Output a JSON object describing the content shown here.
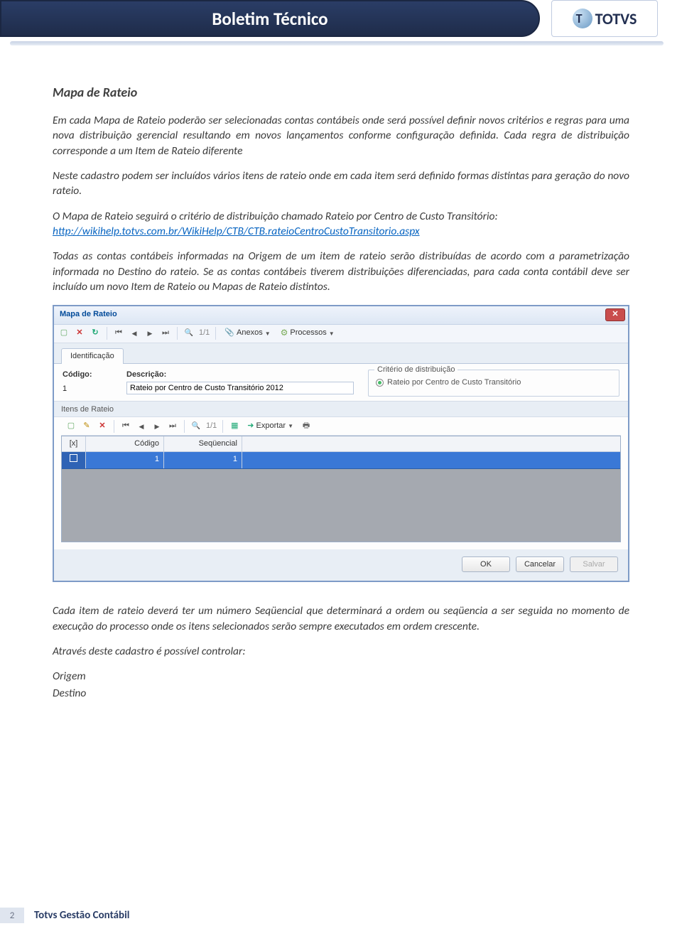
{
  "header": {
    "ribbon_title": "Boletim Técnico",
    "logo_text": "TOTVS"
  },
  "content": {
    "section_title": "Mapa de Rateio",
    "para1": "Em cada Mapa de Rateio poderão ser selecionadas contas contábeis onde será possível definir novos critérios e regras para uma nova distribuição gerencial resultando em novos lançamentos conforme configuração definida. Cada regra de distribuição corresponde a um Item de Rateio diferente",
    "para2": "Neste cadastro podem ser incluídos vários itens de rateio onde em cada item será definido formas distintas para geração do novo rateio.",
    "para3_pre": "O Mapa de Rateio seguirá o critério de distribuição chamado Rateio por Centro de Custo Transitório:",
    "para3_link": "http://wikihelp.totvs.com.br/WikiHelp/CTB/CTB.rateioCentroCustoTransitorio.aspx",
    "para4": "Todas as contas contábeis informadas na Origem de um item de rateio serão distribuídas de acordo com a parametrização informada no Destino do rateio. Se as contas contábeis tiverem distribuições diferenciadas, para cada conta contábil deve ser incluído um novo Item de Rateio ou Mapas de Rateio distintos.",
    "para5": "Cada item de rateio deverá ter um número Seqüencial que determinará a ordem ou seqüencia a ser seguida no momento de execução do processo onde os itens selecionados serão sempre executados em ordem crescente.",
    "para6": "Através deste cadastro é possível controlar:",
    "list": [
      "Origem",
      "Destino"
    ]
  },
  "window": {
    "title": "Mapa de Rateio",
    "toolbar1": {
      "page": "1/1",
      "attach": "Anexos",
      "process": "Processos"
    },
    "tab1": "Identificação",
    "form": {
      "codigo_label": "Código:",
      "codigo_value": "1",
      "desc_label": "Descrição:",
      "desc_value": "Rateio por Centro de Custo Transitório 2012",
      "criterio_legend": "Critério de distribuição",
      "criterio_option": "Rateio por Centro de Custo Transitório"
    },
    "sub_header": "Itens de Rateio",
    "toolbar2": {
      "page": "1/1",
      "export": "Exportar"
    },
    "grid": {
      "col_chk": "[x]",
      "col_cod": "Código",
      "col_seq": "Seqüencial",
      "rows": [
        {
          "codigo": "1",
          "seq": "1"
        }
      ]
    },
    "buttons": {
      "ok": "OK",
      "cancel": "Cancelar",
      "save": "Salvar"
    }
  },
  "footer": {
    "page_number": "2",
    "product": "Totvs Gestão Contábil"
  }
}
